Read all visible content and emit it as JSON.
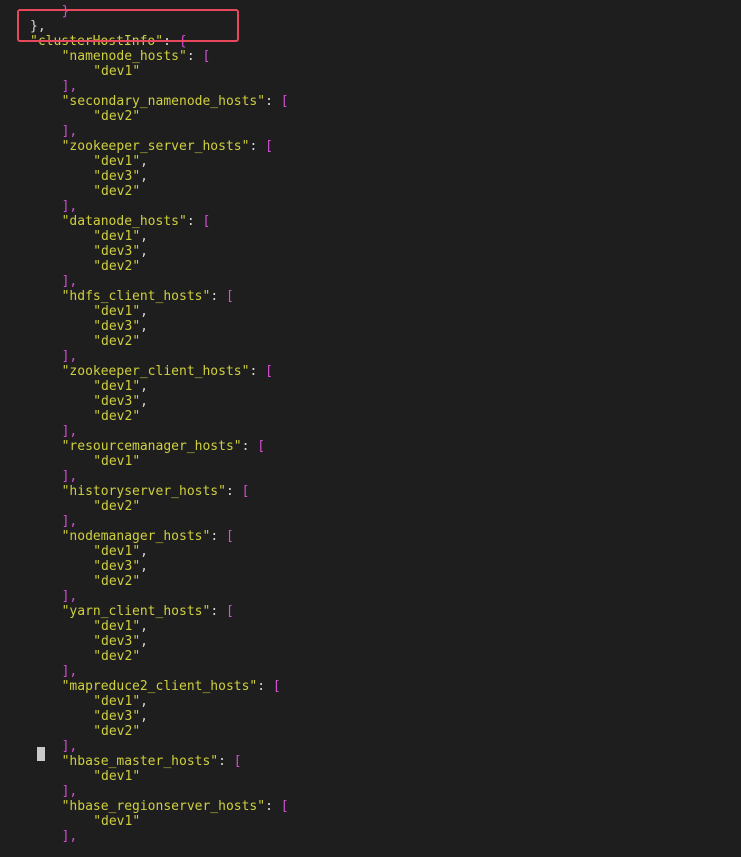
{
  "colors": {
    "background": "#1e1e1e",
    "string": "#cfcf3f",
    "punctuation": "#d8d8d8",
    "bracket": "#d34fd3",
    "highlight_border": "#e8485b",
    "cursor": "#c9c9c9"
  },
  "editor": {
    "lines": [
      {
        "indent": 8,
        "tokens": [
          {
            "t": "}",
            "c": "cut"
          }
        ]
      },
      {
        "indent": 4,
        "tokens": [
          {
            "t": "},",
            "c": "punc"
          }
        ]
      },
      {
        "indent": 4,
        "tokens": [
          {
            "t": "\"clusterHostInfo\"",
            "c": "key"
          },
          {
            "t": ": ",
            "c": "punc"
          },
          {
            "t": "{",
            "c": "bracket"
          }
        ]
      },
      {
        "indent": 8,
        "tokens": [
          {
            "t": "\"namenode_hosts\"",
            "c": "key"
          },
          {
            "t": ": ",
            "c": "punc"
          },
          {
            "t": "[",
            "c": "bracket"
          }
        ]
      },
      {
        "indent": 12,
        "tokens": [
          {
            "t": "\"dev1\"",
            "c": "str"
          }
        ]
      },
      {
        "indent": 8,
        "tokens": [
          {
            "t": "],",
            "c": "bracket"
          }
        ]
      },
      {
        "indent": 8,
        "tokens": [
          {
            "t": "\"secondary_namenode_hosts\"",
            "c": "key"
          },
          {
            "t": ": ",
            "c": "punc"
          },
          {
            "t": "[",
            "c": "bracket"
          }
        ]
      },
      {
        "indent": 12,
        "tokens": [
          {
            "t": "\"dev2\"",
            "c": "str"
          }
        ]
      },
      {
        "indent": 8,
        "tokens": [
          {
            "t": "],",
            "c": "bracket"
          }
        ]
      },
      {
        "indent": 8,
        "tokens": [
          {
            "t": "\"zookeeper_server_hosts\"",
            "c": "key"
          },
          {
            "t": ": ",
            "c": "punc"
          },
          {
            "t": "[",
            "c": "bracket"
          }
        ]
      },
      {
        "indent": 12,
        "tokens": [
          {
            "t": "\"dev1\"",
            "c": "str"
          },
          {
            "t": ",",
            "c": "punc"
          }
        ]
      },
      {
        "indent": 12,
        "tokens": [
          {
            "t": "\"dev3\"",
            "c": "str"
          },
          {
            "t": ",",
            "c": "punc"
          }
        ]
      },
      {
        "indent": 12,
        "tokens": [
          {
            "t": "\"dev2\"",
            "c": "str"
          }
        ]
      },
      {
        "indent": 8,
        "tokens": [
          {
            "t": "],",
            "c": "bracket"
          }
        ]
      },
      {
        "indent": 8,
        "tokens": [
          {
            "t": "\"datanode_hosts\"",
            "c": "key"
          },
          {
            "t": ": ",
            "c": "punc"
          },
          {
            "t": "[",
            "c": "bracket"
          }
        ]
      },
      {
        "indent": 12,
        "tokens": [
          {
            "t": "\"dev1\"",
            "c": "str"
          },
          {
            "t": ",",
            "c": "punc"
          }
        ]
      },
      {
        "indent": 12,
        "tokens": [
          {
            "t": "\"dev3\"",
            "c": "str"
          },
          {
            "t": ",",
            "c": "punc"
          }
        ]
      },
      {
        "indent": 12,
        "tokens": [
          {
            "t": "\"dev2\"",
            "c": "str"
          }
        ]
      },
      {
        "indent": 8,
        "tokens": [
          {
            "t": "],",
            "c": "bracket"
          }
        ]
      },
      {
        "indent": 8,
        "tokens": [
          {
            "t": "\"hdfs_client_hosts\"",
            "c": "key"
          },
          {
            "t": ": ",
            "c": "punc"
          },
          {
            "t": "[",
            "c": "bracket"
          }
        ]
      },
      {
        "indent": 12,
        "tokens": [
          {
            "t": "\"dev1\"",
            "c": "str"
          },
          {
            "t": ",",
            "c": "punc"
          }
        ]
      },
      {
        "indent": 12,
        "tokens": [
          {
            "t": "\"dev3\"",
            "c": "str"
          },
          {
            "t": ",",
            "c": "punc"
          }
        ]
      },
      {
        "indent": 12,
        "tokens": [
          {
            "t": "\"dev2\"",
            "c": "str"
          }
        ]
      },
      {
        "indent": 8,
        "tokens": [
          {
            "t": "],",
            "c": "bracket"
          }
        ]
      },
      {
        "indent": 8,
        "tokens": [
          {
            "t": "\"zookeeper_client_hosts\"",
            "c": "key"
          },
          {
            "t": ": ",
            "c": "punc"
          },
          {
            "t": "[",
            "c": "bracket"
          }
        ]
      },
      {
        "indent": 12,
        "tokens": [
          {
            "t": "\"dev1\"",
            "c": "str"
          },
          {
            "t": ",",
            "c": "punc"
          }
        ]
      },
      {
        "indent": 12,
        "tokens": [
          {
            "t": "\"dev3\"",
            "c": "str"
          },
          {
            "t": ",",
            "c": "punc"
          }
        ]
      },
      {
        "indent": 12,
        "tokens": [
          {
            "t": "\"dev2\"",
            "c": "str"
          }
        ]
      },
      {
        "indent": 8,
        "tokens": [
          {
            "t": "],",
            "c": "bracket"
          }
        ]
      },
      {
        "indent": 8,
        "tokens": [
          {
            "t": "\"resourcemanager_hosts\"",
            "c": "key"
          },
          {
            "t": ": ",
            "c": "punc"
          },
          {
            "t": "[",
            "c": "bracket"
          }
        ]
      },
      {
        "indent": 12,
        "tokens": [
          {
            "t": "\"dev1\"",
            "c": "str"
          }
        ]
      },
      {
        "indent": 8,
        "tokens": [
          {
            "t": "],",
            "c": "bracket"
          }
        ]
      },
      {
        "indent": 8,
        "tokens": [
          {
            "t": "\"historyserver_hosts\"",
            "c": "key"
          },
          {
            "t": ": ",
            "c": "punc"
          },
          {
            "t": "[",
            "c": "bracket"
          }
        ]
      },
      {
        "indent": 12,
        "tokens": [
          {
            "t": "\"dev2\"",
            "c": "str"
          }
        ]
      },
      {
        "indent": 8,
        "tokens": [
          {
            "t": "],",
            "c": "bracket"
          }
        ]
      },
      {
        "indent": 8,
        "tokens": [
          {
            "t": "\"nodemanager_hosts\"",
            "c": "key"
          },
          {
            "t": ": ",
            "c": "punc"
          },
          {
            "t": "[",
            "c": "bracket"
          }
        ]
      },
      {
        "indent": 12,
        "tokens": [
          {
            "t": "\"dev1\"",
            "c": "str"
          },
          {
            "t": ",",
            "c": "punc"
          }
        ]
      },
      {
        "indent": 12,
        "tokens": [
          {
            "t": "\"dev3\"",
            "c": "str"
          },
          {
            "t": ",",
            "c": "punc"
          }
        ]
      },
      {
        "indent": 12,
        "tokens": [
          {
            "t": "\"dev2\"",
            "c": "str"
          }
        ]
      },
      {
        "indent": 8,
        "tokens": [
          {
            "t": "],",
            "c": "bracket"
          }
        ]
      },
      {
        "indent": 8,
        "tokens": [
          {
            "t": "\"yarn_client_hosts\"",
            "c": "key"
          },
          {
            "t": ": ",
            "c": "punc"
          },
          {
            "t": "[",
            "c": "bracket"
          }
        ]
      },
      {
        "indent": 12,
        "tokens": [
          {
            "t": "\"dev1\"",
            "c": "str"
          },
          {
            "t": ",",
            "c": "punc"
          }
        ]
      },
      {
        "indent": 12,
        "tokens": [
          {
            "t": "\"dev3\"",
            "c": "str"
          },
          {
            "t": ",",
            "c": "punc"
          }
        ]
      },
      {
        "indent": 12,
        "tokens": [
          {
            "t": "\"dev2\"",
            "c": "str"
          }
        ]
      },
      {
        "indent": 8,
        "tokens": [
          {
            "t": "],",
            "c": "bracket"
          }
        ]
      },
      {
        "indent": 8,
        "tokens": [
          {
            "t": "\"mapreduce2_client_hosts\"",
            "c": "key"
          },
          {
            "t": ": ",
            "c": "punc"
          },
          {
            "t": "[",
            "c": "bracket"
          }
        ]
      },
      {
        "indent": 12,
        "tokens": [
          {
            "t": "\"dev1\"",
            "c": "str"
          },
          {
            "t": ",",
            "c": "punc"
          }
        ]
      },
      {
        "indent": 12,
        "tokens": [
          {
            "t": "\"dev3\"",
            "c": "str"
          },
          {
            "t": ",",
            "c": "punc"
          }
        ]
      },
      {
        "indent": 12,
        "tokens": [
          {
            "t": "\"dev2\"",
            "c": "str"
          }
        ]
      },
      {
        "indent": 8,
        "tokens": [
          {
            "t": "],",
            "c": "bracket"
          }
        ]
      },
      {
        "indent": 8,
        "tokens": [
          {
            "t": "\"hbase_master_hosts\"",
            "c": "key"
          },
          {
            "t": ": ",
            "c": "punc"
          },
          {
            "t": "[",
            "c": "bracket"
          }
        ]
      },
      {
        "indent": 12,
        "tokens": [
          {
            "t": "\"dev1\"",
            "c": "str"
          }
        ]
      },
      {
        "indent": 8,
        "tokens": [
          {
            "t": "],",
            "c": "bracket"
          }
        ]
      },
      {
        "indent": 8,
        "tokens": [
          {
            "t": "\"hbase_regionserver_hosts\"",
            "c": "key"
          },
          {
            "t": ": ",
            "c": "punc"
          },
          {
            "t": "[",
            "c": "bracket"
          }
        ]
      },
      {
        "indent": 12,
        "tokens": [
          {
            "t": "\"dev1\"",
            "c": "str"
          }
        ]
      },
      {
        "indent": 8,
        "tokens": [
          {
            "t": "],",
            "c": "bracket"
          }
        ]
      }
    ]
  }
}
